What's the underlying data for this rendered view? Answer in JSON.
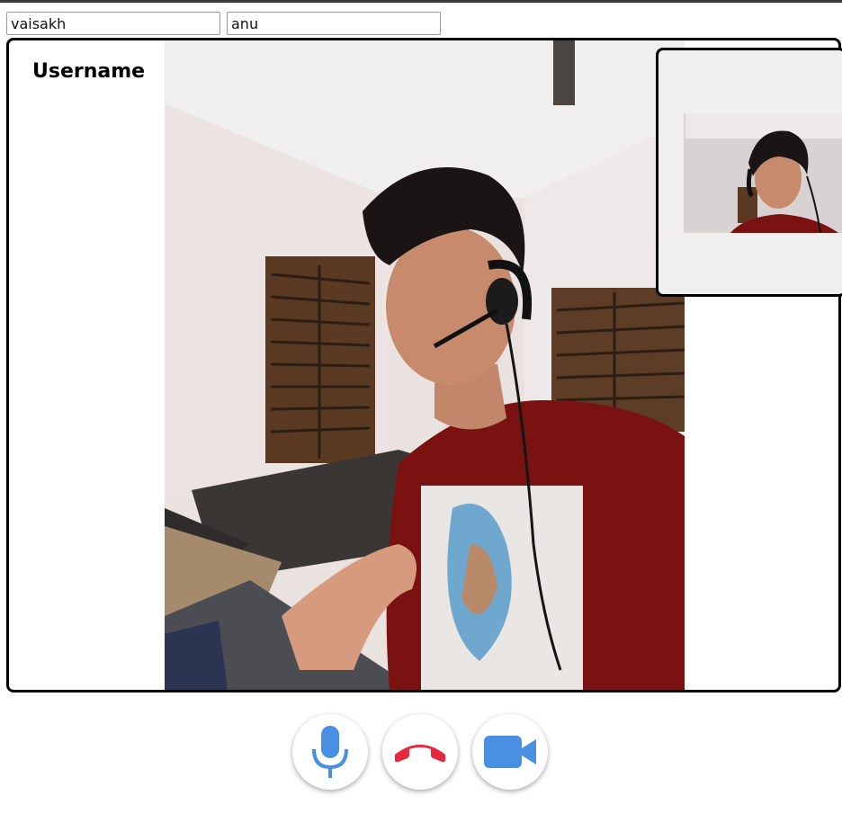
{
  "inputs": {
    "my_name": {
      "value": "vaisakh"
    },
    "peer_name": {
      "value": "anu"
    }
  },
  "stage": {
    "username_label": "Username"
  },
  "controls": {
    "mic": {
      "icon": "microphone-icon",
      "color": "#4a90e2"
    },
    "hangup": {
      "icon": "phone-hangup-icon",
      "color": "#e8283c"
    },
    "camera": {
      "icon": "video-camera-icon",
      "color": "#4a90e2"
    }
  }
}
